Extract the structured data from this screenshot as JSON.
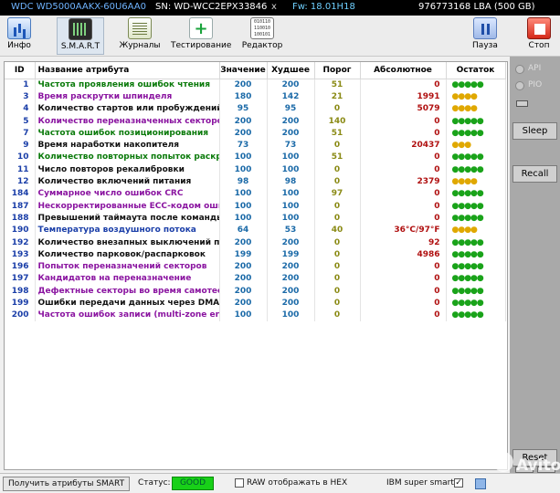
{
  "topbar": {
    "model": "WDC WD5000AAKX-60U6AA0",
    "serial": "SN: WD-WCC2EPX33846",
    "close": "x",
    "firmware": "Fw: 18.01H18",
    "lba": "976773168 LBA (500 GB)"
  },
  "toolbar": {
    "info": "Инфо",
    "smart": "S.M.A.R.T",
    "logs": "Журналы",
    "testing": "Тестирование",
    "editor": "Редактор",
    "pause": "Пауза",
    "stop": "Стоп"
  },
  "table": {
    "headers": {
      "id": "ID",
      "name": "Название атрибута",
      "value": "Значение",
      "worst": "Худшее",
      "threshold": "Порог",
      "raw": "Абсолютное",
      "remaining": "Остаток"
    },
    "rows": [
      {
        "id": "1",
        "name": "Частота проявления ошибок чтения",
        "color": "green",
        "value": "200",
        "worst": "200",
        "threshold": "51",
        "raw": "0",
        "dots": "●●●●●",
        "dot_color": "green"
      },
      {
        "id": "3",
        "name": "Время раскрутки шпинделя",
        "color": "purple",
        "value": "180",
        "worst": "142",
        "threshold": "21",
        "raw": "1991",
        "dots": "●●●●",
        "dot_color": "yellow"
      },
      {
        "id": "4",
        "name": "Количество стартов или пробуждений",
        "color": "black",
        "value": "95",
        "worst": "95",
        "threshold": "0",
        "raw": "5079",
        "dots": "●●●●",
        "dot_color": "yellow"
      },
      {
        "id": "5",
        "name": "Количество переназначенных секторов",
        "color": "purple",
        "value": "200",
        "worst": "200",
        "threshold": "140",
        "raw": "0",
        "dots": "●●●●●",
        "dot_color": "green"
      },
      {
        "id": "7",
        "name": "Частота ошибок позиционирования",
        "color": "green",
        "value": "200",
        "worst": "200",
        "threshold": "51",
        "raw": "0",
        "dots": "●●●●●",
        "dot_color": "green"
      },
      {
        "id": "9",
        "name": "Время наработки накопителя",
        "color": "black",
        "value": "73",
        "worst": "73",
        "threshold": "0",
        "raw": "20437",
        "dots": "●●●",
        "dot_color": "yellow"
      },
      {
        "id": "10",
        "name": "Количество повторных попыток раскру...",
        "color": "green",
        "value": "100",
        "worst": "100",
        "threshold": "51",
        "raw": "0",
        "dots": "●●●●●",
        "dot_color": "green"
      },
      {
        "id": "11",
        "name": "Число повторов рекалибровки",
        "color": "black",
        "value": "100",
        "worst": "100",
        "threshold": "0",
        "raw": "0",
        "dots": "●●●●●",
        "dot_color": "green"
      },
      {
        "id": "12",
        "name": "Количество включений питания",
        "color": "black",
        "value": "98",
        "worst": "98",
        "threshold": "0",
        "raw": "2379",
        "dots": "●●●●",
        "dot_color": "yellow"
      },
      {
        "id": "184",
        "name": "Суммарное число ошибок CRC",
        "color": "purple",
        "value": "100",
        "worst": "100",
        "threshold": "97",
        "raw": "0",
        "dots": "●●●●●",
        "dot_color": "green"
      },
      {
        "id": "187",
        "name": "Нескорректированные ECC-кодом ошибки",
        "color": "purple",
        "value": "100",
        "worst": "100",
        "threshold": "0",
        "raw": "0",
        "dots": "●●●●●",
        "dot_color": "green"
      },
      {
        "id": "188",
        "name": "Превышений таймаута после команды",
        "color": "black",
        "value": "100",
        "worst": "100",
        "threshold": "0",
        "raw": "0",
        "dots": "●●●●●",
        "dot_color": "green"
      },
      {
        "id": "190",
        "name": "Температура воздушного потока",
        "color": "blue",
        "value": "64",
        "worst": "53",
        "threshold": "40",
        "raw": "36°C/97°F",
        "dots": "●●●●",
        "dot_color": "yellow"
      },
      {
        "id": "192",
        "name": "Количество внезапных выключений пит...",
        "color": "black",
        "value": "200",
        "worst": "200",
        "threshold": "0",
        "raw": "92",
        "dots": "●●●●●",
        "dot_color": "green"
      },
      {
        "id": "193",
        "name": "Количество парковок/распарковок",
        "color": "black",
        "value": "199",
        "worst": "199",
        "threshold": "0",
        "raw": "4986",
        "dots": "●●●●●",
        "dot_color": "green"
      },
      {
        "id": "196",
        "name": "Попыток переназначений секторов",
        "color": "purple",
        "value": "200",
        "worst": "200",
        "threshold": "0",
        "raw": "0",
        "dots": "●●●●●",
        "dot_color": "green"
      },
      {
        "id": "197",
        "name": "Кандидатов на переназначение",
        "color": "purple",
        "value": "200",
        "worst": "200",
        "threshold": "0",
        "raw": "0",
        "dots": "●●●●●",
        "dot_color": "green"
      },
      {
        "id": "198",
        "name": "Дефектные секторы во время самотеста",
        "color": "purple",
        "value": "200",
        "worst": "200",
        "threshold": "0",
        "raw": "0",
        "dots": "●●●●●",
        "dot_color": "green"
      },
      {
        "id": "199",
        "name": "Ошибки передачи данных через DMA",
        "color": "black",
        "value": "200",
        "worst": "200",
        "threshold": "0",
        "raw": "0",
        "dots": "●●●●●",
        "dot_color": "green"
      },
      {
        "id": "200",
        "name": "Частота ошибок записи (multi-zone errors)",
        "color": "purple",
        "value": "100",
        "worst": "100",
        "threshold": "0",
        "raw": "0",
        "dots": "●●●●●",
        "dot_color": "green"
      }
    ]
  },
  "side": {
    "api": "API",
    "pio": "PIO",
    "sleep": "Sleep",
    "recall": "Recall",
    "reset": "Reset"
  },
  "status": {
    "get_smart": "Получить атрибуты SMART",
    "status_label": "Статус:",
    "status_value": "GOOD",
    "hex_label": "RAW отображать в HEX",
    "ibm_label": "IBM super smart:",
    "ibm_checked": "✓"
  },
  "watermark": "Avito"
}
